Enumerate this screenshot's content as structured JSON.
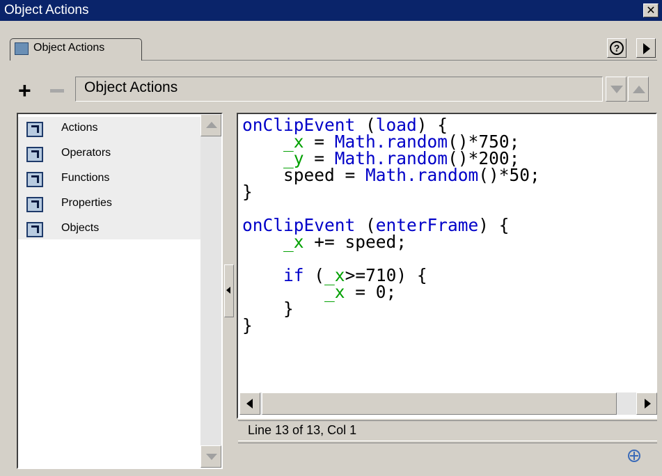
{
  "window": {
    "title": "Object Actions",
    "close_glyph": "✕"
  },
  "tab": {
    "label": "Object Actions",
    "icon": "arrow-book-icon"
  },
  "header": {
    "help_glyph": "?",
    "menu_icon": "panel-menu-arrow-icon"
  },
  "toolbar": {
    "add_glyph": "+",
    "remove_icon": "minus-icon",
    "dropdown_label": "Object Actions",
    "move_down_icon": "move-down-icon",
    "move_up_icon": "move-up-icon"
  },
  "sidebar": {
    "items": [
      {
        "label": "Actions",
        "icon": "book-icon"
      },
      {
        "label": "Operators",
        "icon": "book-icon"
      },
      {
        "label": "Functions",
        "icon": "book-icon"
      },
      {
        "label": "Properties",
        "icon": "book-icon"
      },
      {
        "label": "Objects",
        "icon": "book-icon"
      }
    ]
  },
  "code": {
    "lines": [
      [
        {
          "t": "onClipEvent",
          "c": "kw"
        },
        {
          "t": " (",
          "c": ""
        },
        {
          "t": "load",
          "c": "kw"
        },
        {
          "t": ") {",
          "c": ""
        }
      ],
      [
        {
          "t": "    ",
          "c": ""
        },
        {
          "t": "_x",
          "c": "pr"
        },
        {
          "t": " = ",
          "c": ""
        },
        {
          "t": "Math.random",
          "c": "kw"
        },
        {
          "t": "()*750;",
          "c": ""
        }
      ],
      [
        {
          "t": "    ",
          "c": ""
        },
        {
          "t": "_y",
          "c": "pr"
        },
        {
          "t": " = ",
          "c": ""
        },
        {
          "t": "Math.random",
          "c": "kw"
        },
        {
          "t": "()*200;",
          "c": ""
        }
      ],
      [
        {
          "t": "    speed = ",
          "c": ""
        },
        {
          "t": "Math.random",
          "c": "kw"
        },
        {
          "t": "()*50;",
          "c": ""
        }
      ],
      [
        {
          "t": "}",
          "c": ""
        }
      ],
      [
        {
          "t": "",
          "c": ""
        }
      ],
      [
        {
          "t": "onClipEvent",
          "c": "kw"
        },
        {
          "t": " (",
          "c": ""
        },
        {
          "t": "enterFrame",
          "c": "kw"
        },
        {
          "t": ") {",
          "c": ""
        }
      ],
      [
        {
          "t": "    ",
          "c": ""
        },
        {
          "t": "_x",
          "c": "pr"
        },
        {
          "t": " += speed;",
          "c": ""
        }
      ],
      [
        {
          "t": "",
          "c": ""
        }
      ],
      [
        {
          "t": "    ",
          "c": ""
        },
        {
          "t": "if",
          "c": "kw"
        },
        {
          "t": " (",
          "c": ""
        },
        {
          "t": "_x",
          "c": "pr"
        },
        {
          "t": ">=710) {",
          "c": ""
        }
      ],
      [
        {
          "t": "        ",
          "c": ""
        },
        {
          "t": "_x",
          "c": "pr"
        },
        {
          "t": " = 0;",
          "c": ""
        }
      ],
      [
        {
          "t": "    }",
          "c": ""
        }
      ],
      [
        {
          "t": "}",
          "c": ""
        }
      ]
    ]
  },
  "status": {
    "text": "Line 13 of 13, Col 1"
  },
  "footer": {
    "icon": "target-icon"
  },
  "colors": {
    "titlebar": "#0a246a",
    "keyword": "#0000c8",
    "property": "#00a000",
    "panel": "#d4d0c8"
  }
}
